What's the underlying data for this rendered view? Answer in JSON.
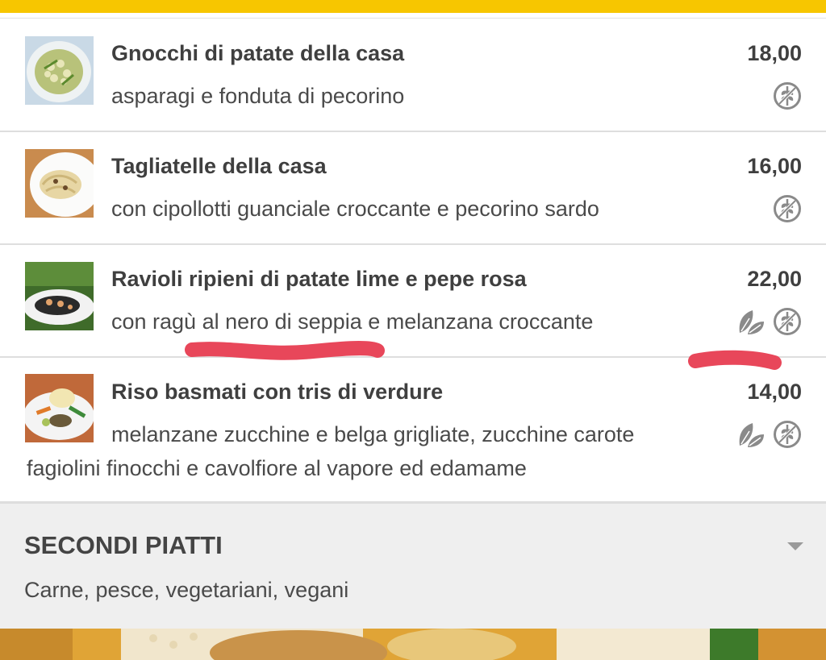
{
  "menu": {
    "items": [
      {
        "name": "Gnocchi di patate della casa",
        "price": "18,00",
        "description": "asparagi e fonduta di pecorino",
        "icons": [
          "gluten-free-icon"
        ]
      },
      {
        "name": "Tagliatelle della casa",
        "price": "16,00",
        "description": "con cipollotti guanciale croccante e pecorino sardo",
        "icons": [
          "gluten-free-icon"
        ]
      },
      {
        "name": "Ravioli ripieni di patate lime e pepe rosa",
        "price": "22,00",
        "description": "con ragù al nero di seppia e melanzana croccante",
        "icons": [
          "vegetarian-leaf-icon",
          "gluten-free-icon"
        ]
      },
      {
        "name": "Riso basmati con tris di verdure",
        "price": "14,00",
        "description_line1": "melanzane zucchine e belga grigliate, zucchine carote",
        "description_line2": "fagiolini finocchi e cavolfiore al vapore ed edamame",
        "icons": [
          "vegetarian-leaf-icon",
          "gluten-free-icon"
        ]
      }
    ]
  },
  "section": {
    "title": "SECONDI PIATTI",
    "subtitle": "Carne, pesce, vegetariani, vegani",
    "toggle_icon": "chevron-down-icon"
  },
  "colors": {
    "accent_bar": "#f7c600",
    "annotation_red": "#e8475a",
    "icon_gray": "#8a8a8a"
  }
}
